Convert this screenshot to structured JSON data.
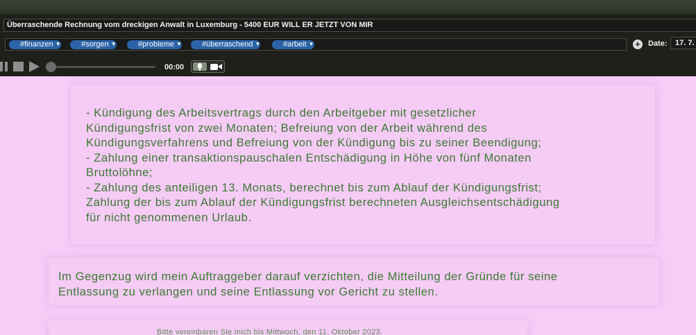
{
  "header": {
    "title": "Überraschende Rechnung vom dreckigen Anwalt in Luxemburg - 5400 EUR WILL ER JETZT VON MIR",
    "tags": [
      "#finanzen",
      "#sorgen",
      "#probleme",
      "#überraschend",
      "#arbeit"
    ],
    "date_label": "Date:",
    "date_value": "17. 7."
  },
  "player": {
    "time": "00:00"
  },
  "icons": {
    "tag_chevron": "chevron-down-icon",
    "add": "plus-circle-icon",
    "pause": "pause-icon",
    "stop": "stop-icon",
    "play": "play-icon",
    "microphone": "microphone-icon",
    "camera": "video-camera-icon"
  },
  "content": {
    "paragraph_1": "- Kündigung des Arbeitsvertrags durch den Arbeitgeber mit gesetzlicher\nKündigungsfrist von zwei Monaten; Befreiung von der Arbeit während des\nKündigungsverfahrens und Befreiung von der Kündigung bis zu seiner Beendigung;\n- Zahlung einer transaktionspauschalen Entschädigung in Höhe von fünf Monaten\nBruttolöhne;\n- Zahlung des anteiligen 13. Monats, berechnet bis zum Ablauf der Kündigungsfrist;\nZahlung der bis zum Ablauf der Kündigungsfrist berechneten Ausgleichsentschädigung\nfür nicht genommenen Urlaub.",
    "paragraph_2": "Im Gegenzug wird mein Auftraggeber darauf verzichten, die Mitteilung der Gründe für seine\nEntlassung zu verlangen und seine Entlassung vor Gericht zu stellen.",
    "paragraph_3": "Bitte vereinbaren Sie mich bis Mittwoch, den 11. Oktober 2023."
  },
  "colors": {
    "toolbar_bg": "#1f1f1c",
    "tag_bg": "#2b63a8",
    "page_bg": "#f7ccf7",
    "text": "#3a7a30"
  }
}
